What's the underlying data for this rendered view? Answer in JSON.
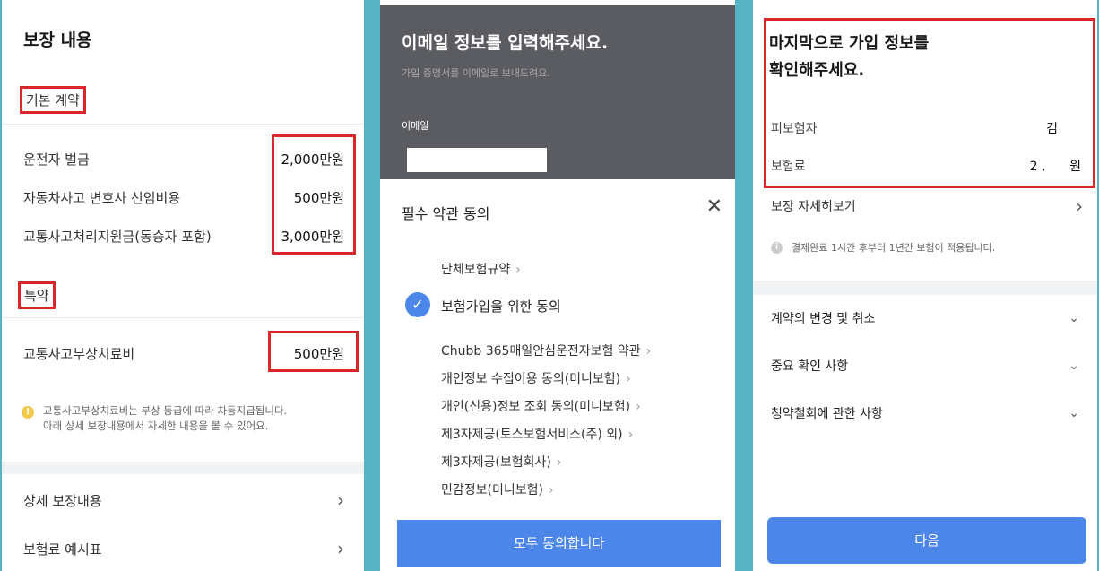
{
  "coverage_screen": {
    "title": "보장 내용",
    "basic_section": "기본 계약",
    "basic_rows": [
      {
        "label": "운전자 벌금",
        "value": "2,000만원"
      },
      {
        "label": "자동차사고 변호사 선임비용",
        "value": "500만원"
      },
      {
        "label": "교통사고처리지원금(동승자 포함)",
        "value": "3,000만원"
      }
    ],
    "special_section": "특약",
    "special_rows": [
      {
        "label": "교통사고부상치료비",
        "value": "500만원"
      }
    ],
    "note_icon": "!",
    "note_line1": "교통사고부상치료비는 부상 등급에 따라 차등지급됩니다.",
    "note_line2": "아래 상세 보장내용에서 자세한 내용을 볼 수 있어요.",
    "links": [
      "상세 보장내용",
      "보험료 예시표"
    ],
    "chevron": "›"
  },
  "email_screen": {
    "heading": "이메일 정보를 입력해주세요.",
    "subtext": "가입 증명서를 이메일로 보내드려요.",
    "email_label": "이메일",
    "email_value": "",
    "sheet_title": "필수 약관 동의",
    "close_glyph": "✕",
    "group_terms": "단체보험규약",
    "consent_main": "보험가입을 위한 동의",
    "check_glyph": "✓",
    "terms": [
      "Chubb 365매일안심운전자보험 약관",
      "개인정보 수집이용 동의(미니보험)",
      "개인(신용)정보 조회 동의(미니보험)",
      "제3자제공(토스보험서비스(주) 외)",
      "제3자제공(보험회사)",
      "민감정보(미니보험)"
    ],
    "arrow": "›",
    "agree_all_button": "모두 동의합니다"
  },
  "confirm_screen": {
    "heading_line1": "마지막으로 가입 정보를",
    "heading_line2": "확인해주세요.",
    "insured_label": "피보험자",
    "insured_value": "김",
    "premium_label": "보험료",
    "premium_value": "2 ,      원",
    "detail_link": "보장 자세히보기",
    "chevron": "›",
    "info_icon": "i",
    "notice": "결제완료 1시간 후부터 1년간 보험이 적용됩니다.",
    "accordions": [
      "계약의 변경 및 취소",
      "중요 확인 사항",
      "청약철회에 관한 사항"
    ],
    "down_glyph": "⌄",
    "next_button": "다음"
  },
  "colors": {
    "background_teal": "#56b4c4",
    "highlight_red": "#d9262b",
    "primary_blue": "#4b86e8",
    "overlay_dark": "#5b5c62"
  }
}
